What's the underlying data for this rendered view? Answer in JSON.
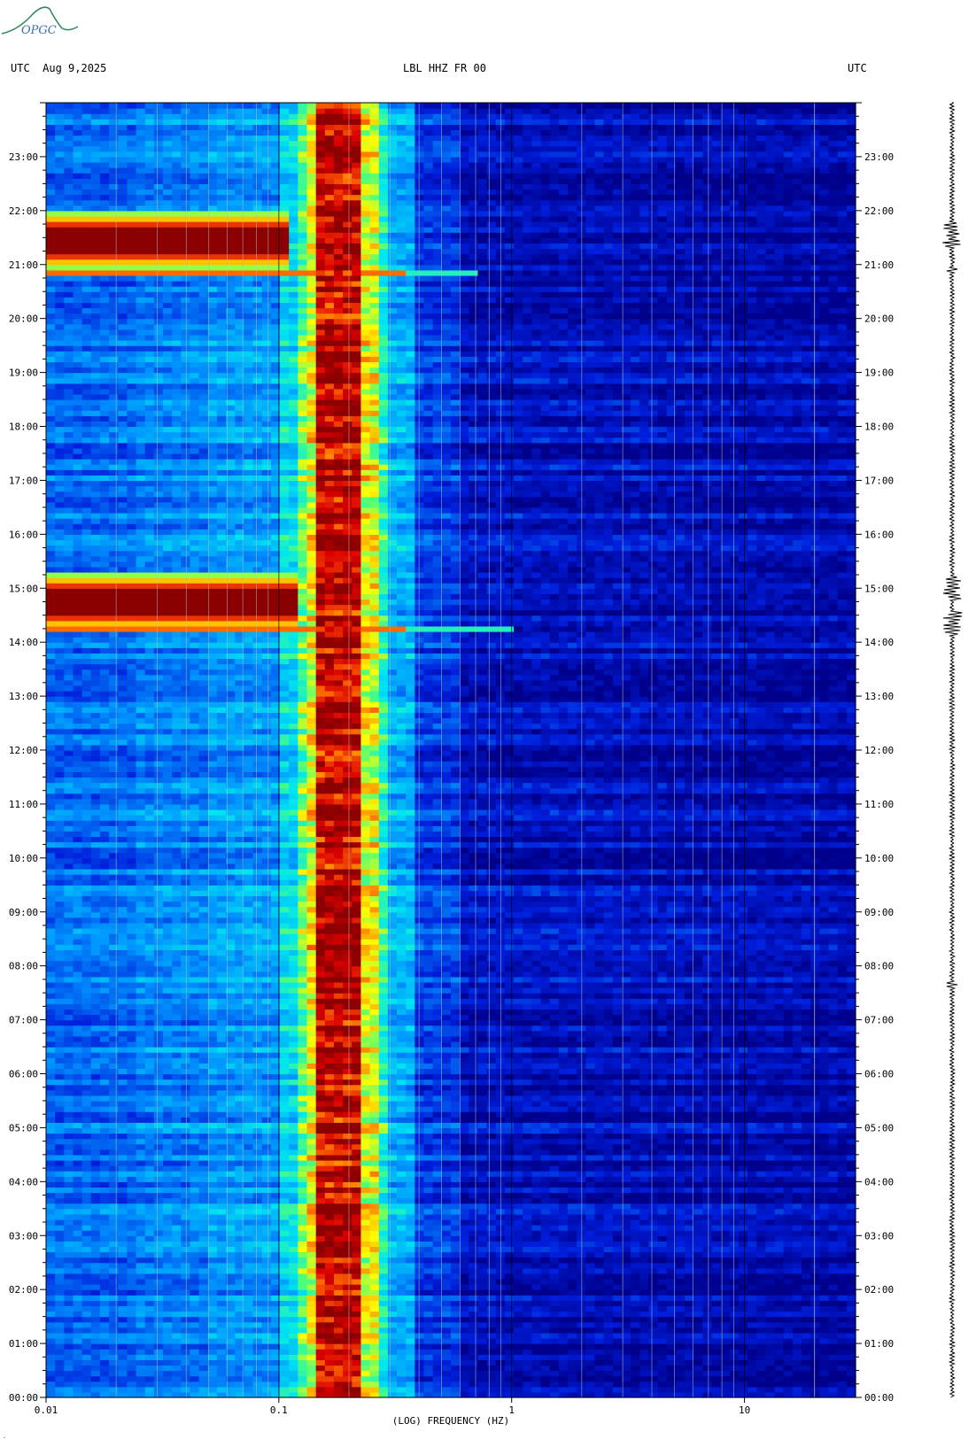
{
  "header": {
    "left": "UTC  Aug 9,2025",
    "center": "LBL HHZ FR 00",
    "right": "UTC"
  },
  "logo": {
    "text": "OPGC",
    "icon": "mountain-logo-icon",
    "color": "#2e8b57"
  },
  "colors": {
    "background": "#00008b",
    "low": "#0028d8",
    "mid": "#00c8ff",
    "high": "#ffff00",
    "peak": "#8b0000"
  },
  "chart_data": {
    "type": "heatmap",
    "title": "LBL HHZ FR 00",
    "xlabel": "(LOG) FREQUENCY (HZ)",
    "ylabel": "UTC",
    "x_scale": "log",
    "xlim": [
      0.01,
      30
    ],
    "x_ticks": [
      {
        "value": 0.01,
        "label": "0.01"
      },
      {
        "value": 0.1,
        "label": "0.1"
      },
      {
        "value": 1,
        "label": "1"
      },
      {
        "value": 10,
        "label": "10"
      }
    ],
    "y_ticks": [
      "00:00",
      "01:00",
      "02:00",
      "03:00",
      "04:00",
      "05:00",
      "06:00",
      "07:00",
      "08:00",
      "09:00",
      "10:00",
      "11:00",
      "12:00",
      "13:00",
      "14:00",
      "15:00",
      "16:00",
      "17:00",
      "18:00",
      "19:00",
      "20:00",
      "21:00",
      "22:00",
      "23:00"
    ],
    "ylim_hours": [
      0,
      24
    ],
    "microseism_band_hz": [
      0.13,
      0.3
    ],
    "microseism_peak_hz": [
      0.15,
      0.22
    ],
    "events": [
      {
        "start_hour": 14.2,
        "end_hour": 15.3,
        "max_freq_hz": 0.12,
        "line_hour": 14.25,
        "line_max_freq_hz": 1.0
      },
      {
        "start_hour": 20.9,
        "end_hour": 22.0,
        "max_freq_hz": 0.11,
        "line_hour": 20.85,
        "line_max_freq_hz": 0.7
      }
    ],
    "trace": {
      "bursts_hours": [
        14.35,
        15.0,
        21.55
      ],
      "spikes_hours": [
        20.9,
        7.65
      ]
    }
  }
}
